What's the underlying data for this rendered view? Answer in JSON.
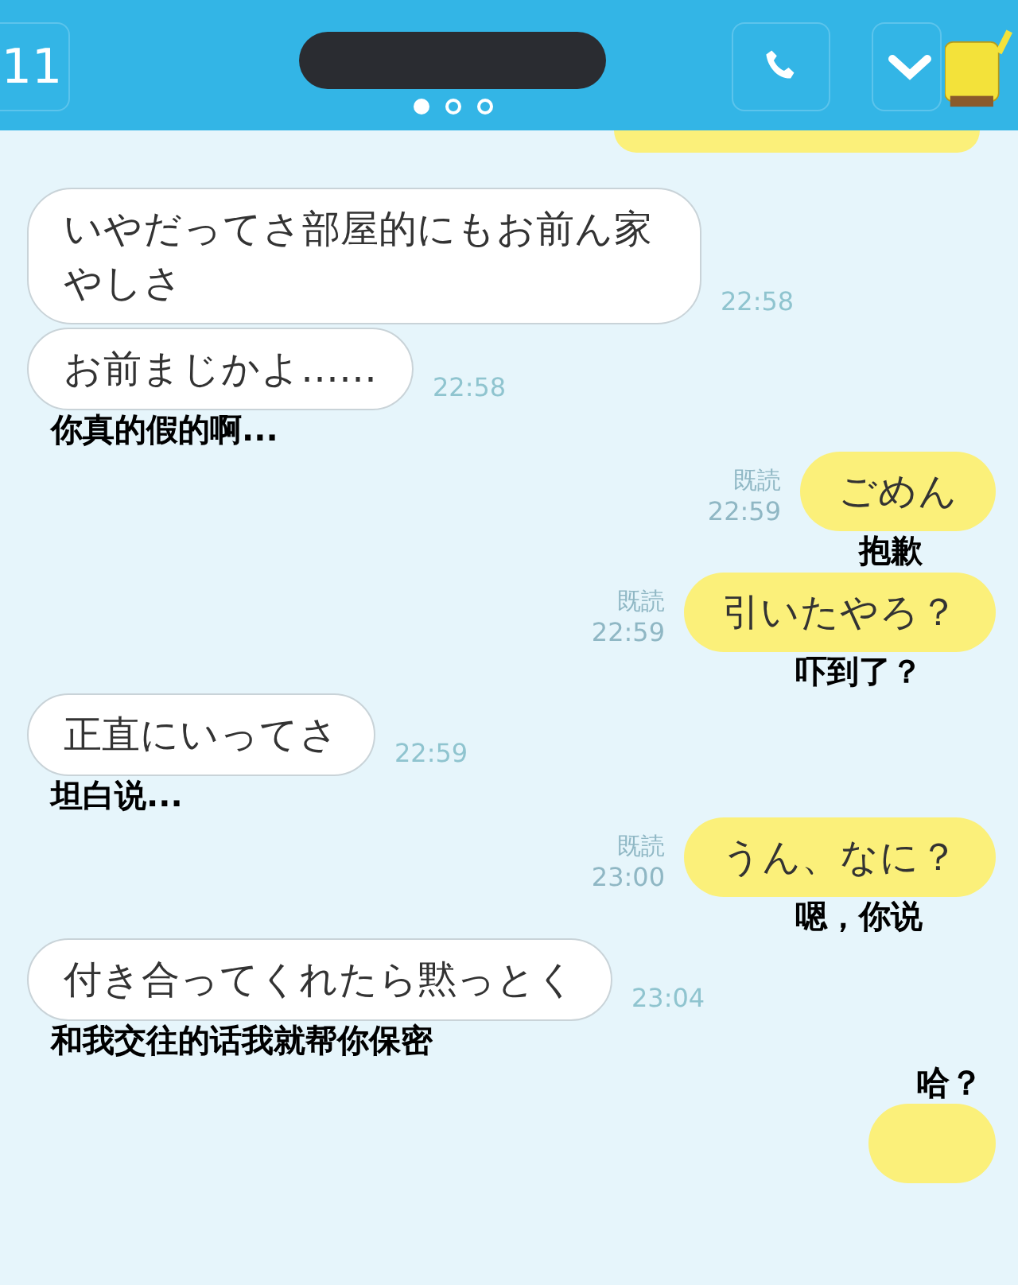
{
  "header": {
    "back_count": "11",
    "page_dots": [
      {
        "selected": true
      },
      {
        "selected": false
      },
      {
        "selected": false
      }
    ]
  },
  "messages": [
    {
      "kind": "received",
      "text": "いやだってさ部屋的にもお前ん家やしさ",
      "time": "22:58"
    },
    {
      "kind": "received",
      "text": "お前まじかよ……",
      "time": "22:58",
      "note": "你真的假的啊..."
    },
    {
      "kind": "sent",
      "text": "ごめん",
      "read_label": "既読",
      "time": "22:59",
      "note": "抱歉"
    },
    {
      "kind": "sent",
      "text": "引いたやろ？",
      "read_label": "既読",
      "time": "22:59",
      "note": "吓到了？"
    },
    {
      "kind": "received",
      "text": "正直にいってさ",
      "time": "22:59",
      "note": "坦白说..."
    },
    {
      "kind": "sent",
      "text": "うん、なに？",
      "read_label": "既読",
      "time": "23:00",
      "note": "嗯，你说"
    },
    {
      "kind": "received",
      "text": "付き合ってくれたら黙っとく",
      "time": "23:04",
      "note": "和我交往的话我就帮你保密"
    },
    {
      "kind": "sent",
      "note_above": "哈？"
    }
  ]
}
